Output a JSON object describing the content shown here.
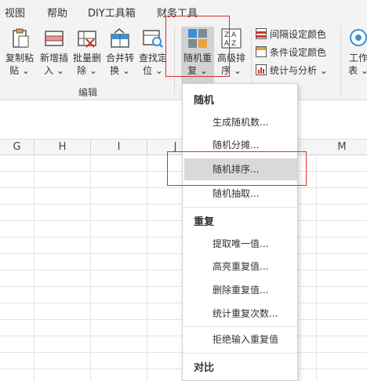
{
  "tabs": [
    "视图",
    "帮助",
    "DIY工具箱",
    "财务工具"
  ],
  "ribbon": {
    "buttons": [
      {
        "l1": "复制粘",
        "l2": "贴 ⌄"
      },
      {
        "l1": "新增插",
        "l2": "入 ⌄"
      },
      {
        "l1": "批量删",
        "l2": "除 ⌄"
      },
      {
        "l1": "合并转",
        "l2": "换 ⌄"
      },
      {
        "l1": "查找定",
        "l2": "位 ⌄"
      },
      {
        "l1": "随机重",
        "l2": "复 ⌄"
      },
      {
        "l1": "高级排",
        "l2": "序 ⌄"
      }
    ],
    "group_label": "编辑",
    "small_items": [
      "间隔设定颜色",
      "条件设定颜色",
      "统计与分析 ⌄"
    ],
    "right_button": {
      "l1": "工作",
      "l2": "表 ⌄"
    }
  },
  "columns": [
    "G",
    "H",
    "I",
    "J",
    "M"
  ],
  "menu": {
    "sections": [
      {
        "header": "随机",
        "items": [
          "生成随机数...",
          "随机分摊...",
          "随机排序...",
          "随机抽取..."
        ]
      },
      {
        "header": "重复",
        "items": [
          "提取唯一值...",
          "高亮重复值...",
          "删除重复值...",
          "统计重复次数...",
          "拒绝输入重复值"
        ]
      },
      {
        "header": "对比",
        "items": []
      }
    ],
    "highlighted": "随机排序..."
  },
  "colors": {
    "ribbon_bg": "#f3f3f3",
    "highlight": "#d9d9d9",
    "annotation_red": "#d9302c"
  }
}
